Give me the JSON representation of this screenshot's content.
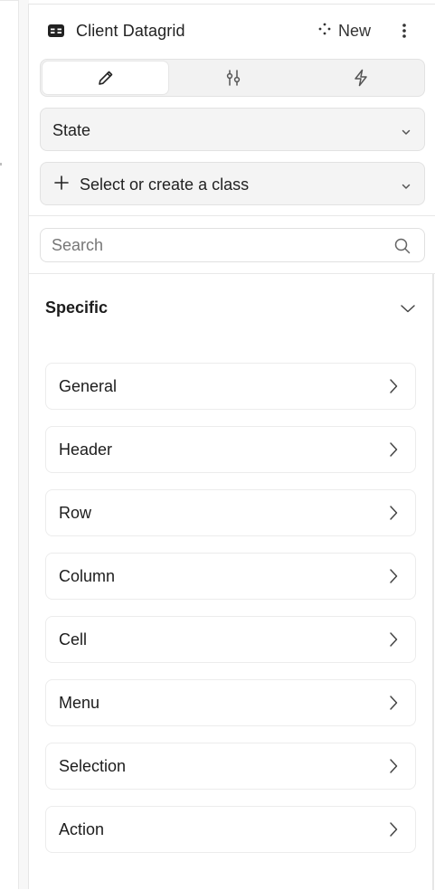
{
  "colors": {
    "panel_bg": "#ffffff",
    "field_bg": "#f4f4f4",
    "border": "#e2e2e2",
    "text": "#1c1c1c"
  },
  "header": {
    "title": "Client Datagrid",
    "component_icon": "table-icon",
    "new_label": "New",
    "new_icon": "move-icon",
    "more_icon": "more-vertical-icon"
  },
  "tabs": [
    {
      "name": "style",
      "icon": "pencil-icon",
      "active": true
    },
    {
      "name": "settings",
      "icon": "sliders-icon",
      "active": false
    },
    {
      "name": "interactions",
      "icon": "lightning-icon",
      "active": false
    }
  ],
  "state_select": {
    "value": "State"
  },
  "class_select": {
    "value": "Select or create a class"
  },
  "search": {
    "placeholder": "Search",
    "value": ""
  },
  "section": {
    "title": "Specific",
    "expanded": true
  },
  "items": [
    "General",
    "Header",
    "Row",
    "Column",
    "Cell",
    "Menu",
    "Selection",
    "Action"
  ]
}
